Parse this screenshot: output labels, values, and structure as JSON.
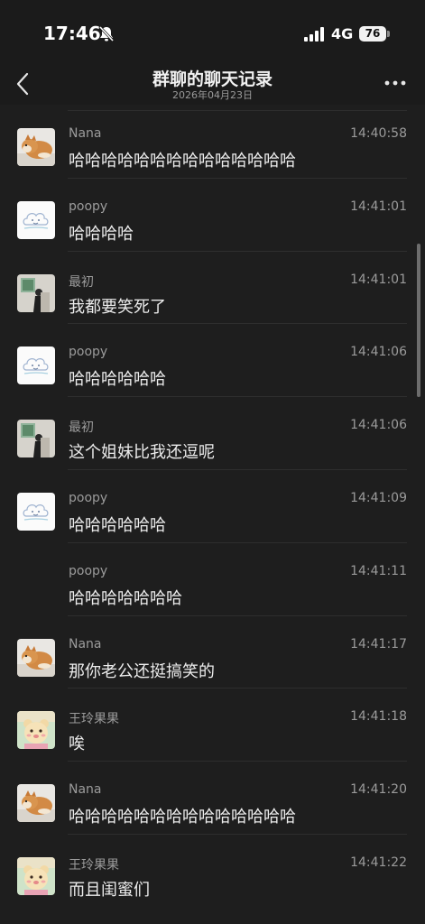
{
  "status_bar": {
    "time": "17:46",
    "network": "4G",
    "battery": "76",
    "icons": [
      "bell-muted-icon",
      "signal-icon",
      "battery-icon"
    ]
  },
  "header": {
    "title": "群聊的聊天记录",
    "date": "2026年04月23日",
    "back_icon": "chevron-left-icon",
    "more_icon": "more-dots-icon"
  },
  "messages": [
    {
      "sender": "Nana",
      "time": "14:40:58",
      "text": "哈哈哈哈哈哈哈哈哈哈哈哈哈哈",
      "avatar": "shiba"
    },
    {
      "sender": "poopy",
      "time": "14:41:01",
      "text": "哈哈哈哈",
      "avatar": "cloud"
    },
    {
      "sender": "最初",
      "time": "14:41:01",
      "text": "我都要笑死了",
      "avatar": "person"
    },
    {
      "sender": "poopy",
      "time": "14:41:06",
      "text": "哈哈哈哈哈哈",
      "avatar": "cloud"
    },
    {
      "sender": "最初",
      "time": "14:41:06",
      "text": "这个姐妹比我还逗呢",
      "avatar": "person"
    },
    {
      "sender": "poopy",
      "time": "14:41:09",
      "text": "哈哈哈哈哈哈",
      "avatar": "cloud"
    },
    {
      "sender": "poopy",
      "time": "14:41:11",
      "text": "哈哈哈哈哈哈哈",
      "avatar": "none"
    },
    {
      "sender": "Nana",
      "time": "14:41:17",
      "text": "那你老公还挺搞笑的",
      "avatar": "shiba"
    },
    {
      "sender": "王玲果果",
      "time": "14:41:18",
      "text": "唉",
      "avatar": "bear"
    },
    {
      "sender": "Nana",
      "time": "14:41:20",
      "text": "哈哈哈哈哈哈哈哈哈哈哈哈哈哈",
      "avatar": "shiba"
    },
    {
      "sender": "王玲果果",
      "time": "14:41:22",
      "text": "而且闺蜜们",
      "avatar": "bear"
    }
  ]
}
